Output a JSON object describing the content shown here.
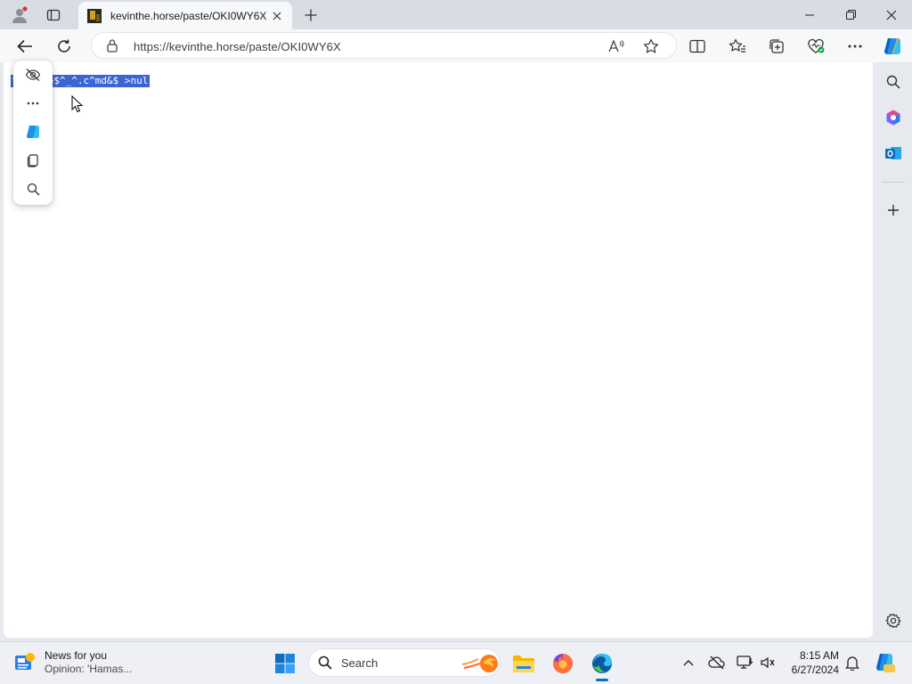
{
  "browser": {
    "tab": {
      "title": "kevinthe.horse/paste/OKI0WY6X"
    },
    "address": {
      "url": "https://kevinthe.horse/paste/OKI0WY6X"
    }
  },
  "page": {
    "selected_text": "%0^|%0>$^_^.c^md&$ >nul"
  },
  "mini_menu": {
    "items": [
      "hide-menu-icon",
      "more-icon",
      "copilot-icon",
      "copy-icon",
      "search-icon"
    ]
  },
  "taskbar": {
    "news": {
      "title": "News for you",
      "subtitle": "Opinion: 'Hamas..."
    },
    "search_label": "Search",
    "clock": {
      "time": "8:15 AM",
      "date": "6/27/2024"
    }
  },
  "colors": {
    "selection": "#3a65d3",
    "accent": "#0f6cbd"
  }
}
